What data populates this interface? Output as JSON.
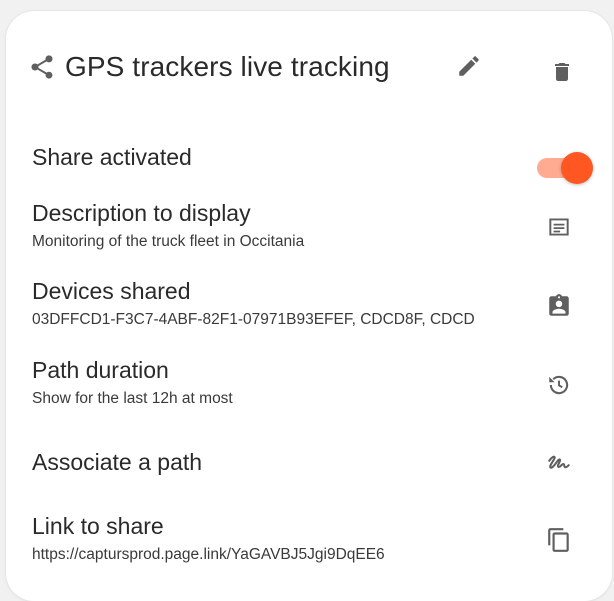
{
  "header": {
    "title": "GPS trackers live tracking",
    "share_icon": "share-icon",
    "edit_icon": "pencil-icon",
    "delete_icon": "trash-icon"
  },
  "share": {
    "label": "Share activated",
    "enabled": true,
    "accent_color": "#ff5722"
  },
  "description": {
    "label": "Description to display",
    "value": "Monitoring of the truck fleet in Occitania",
    "icon": "subject-icon"
  },
  "devices": {
    "label": "Devices shared",
    "value": "03DFFCD1-F3C7-4ABF-82F1-07971B93EFEF, CDCD8F, CDCD",
    "icon": "assignment-ind-icon"
  },
  "path_duration": {
    "label": "Path duration",
    "value": "Show for the last 12h at most",
    "icon": "history-icon"
  },
  "associate_path": {
    "label": "Associate a path",
    "icon": "gesture-icon"
  },
  "link": {
    "label": "Link to share",
    "value": "https://captursprod.page.link/YaGAVBJ5Jgi9DqEE6",
    "icon": "copy-icon"
  }
}
